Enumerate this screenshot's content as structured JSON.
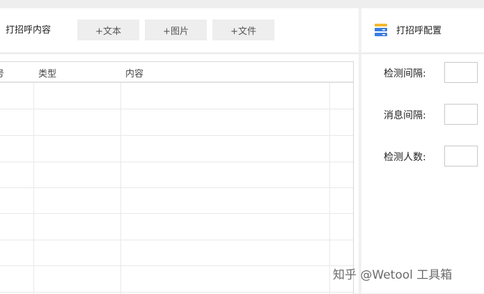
{
  "toolbar": {
    "title": "打招呼内容",
    "add_text_label": "+文本",
    "add_image_label": "+图片",
    "add_file_label": "+文件"
  },
  "config": {
    "icon": "stacked-layers-icon",
    "title": "打招呼配置",
    "fields": [
      {
        "label": "检测间隔:",
        "value": ""
      },
      {
        "label": "消息间隔:",
        "value": ""
      },
      {
        "label": "检测人数:",
        "value": ""
      }
    ]
  },
  "table": {
    "columns": [
      "号",
      "类型",
      "内容"
    ],
    "rows": []
  },
  "watermark": "知乎 @Wetool 工具箱",
  "colors": {
    "accent_blue": "#3b7de0",
    "accent_yellow": "#f5b82e"
  }
}
